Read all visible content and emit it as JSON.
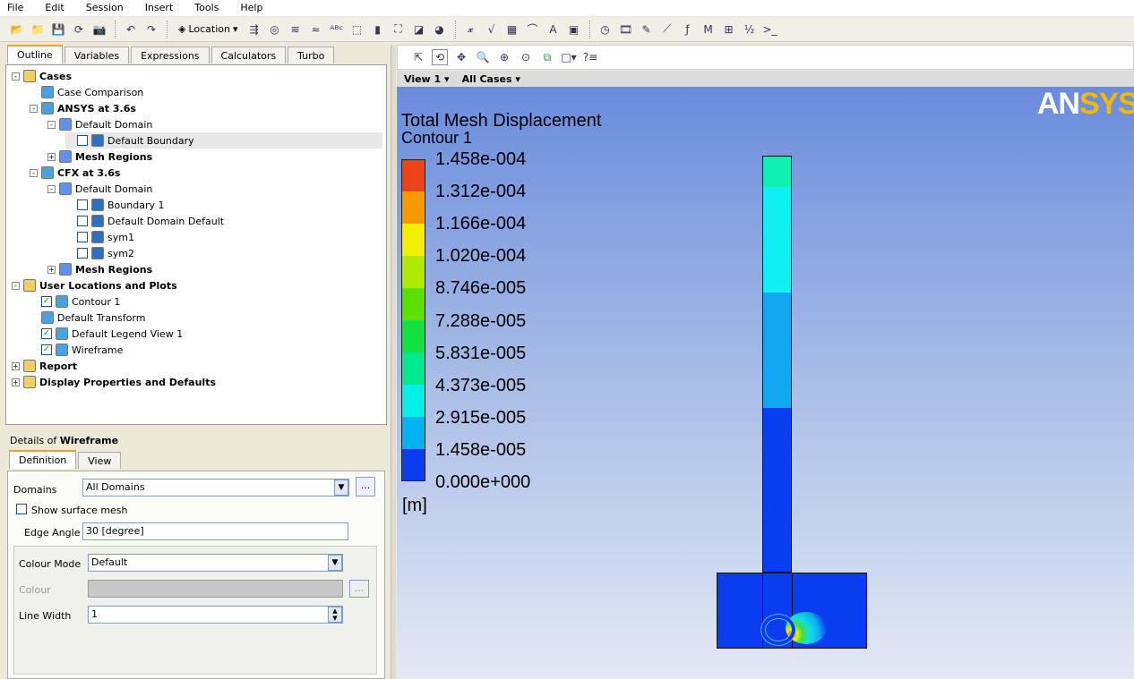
{
  "menu": [
    "File",
    "Edit",
    "Session",
    "Insert",
    "Tools",
    "Help"
  ],
  "toolbar": {
    "location_label": "Location"
  },
  "left_tabs": [
    "Outline",
    "Variables",
    "Expressions",
    "Calculators",
    "Turbo"
  ],
  "tree": [
    {
      "label": "Cases",
      "bold": true,
      "level": 0,
      "exp": "-"
    },
    {
      "label": "Case Comparison",
      "level": 1
    },
    {
      "label": "ANSYS at 3.6s",
      "bold": true,
      "level": 1,
      "exp": "-"
    },
    {
      "label": "Default Domain",
      "level": 2,
      "exp": "-"
    },
    {
      "label": "Default Boundary",
      "level": 3,
      "check": false,
      "selected": true
    },
    {
      "label": "Mesh Regions",
      "bold": true,
      "level": 2,
      "exp": "+"
    },
    {
      "label": "CFX at 3.6s",
      "bold": true,
      "level": 1,
      "exp": "-"
    },
    {
      "label": "Default Domain",
      "level": 2,
      "exp": "-"
    },
    {
      "label": "Boundary 1",
      "level": 3,
      "check": false
    },
    {
      "label": "Default Domain Default",
      "level": 3,
      "check": false
    },
    {
      "label": "sym1",
      "level": 3,
      "check": false
    },
    {
      "label": "sym2",
      "level": 3,
      "check": false
    },
    {
      "label": "Mesh Regions",
      "bold": true,
      "level": 2,
      "exp": "+"
    },
    {
      "label": "User Locations and Plots",
      "bold": true,
      "level": 0,
      "exp": "-"
    },
    {
      "label": "Contour 1",
      "level": 1,
      "check": true
    },
    {
      "label": "Default Transform",
      "level": 1
    },
    {
      "label": "Default Legend View 1",
      "level": 1,
      "check": true
    },
    {
      "label": "Wireframe",
      "level": 1,
      "check": true
    },
    {
      "label": "Report",
      "bold": true,
      "level": 0,
      "exp": "+"
    },
    {
      "label": "Display Properties and Defaults",
      "bold": true,
      "level": 0,
      "exp": "+"
    }
  ],
  "details": {
    "title_prefix": "Details of ",
    "title_object": "Wireframe",
    "tabs": [
      "Definition",
      "View"
    ],
    "domains_label": "Domains",
    "domains_value": "All Domains",
    "more": "...",
    "show_mesh_label": "Show surface mesh",
    "edge_angle_label": "Edge Angle",
    "edge_angle_value": "30 [degree]",
    "colour_mode_label": "Colour Mode",
    "colour_mode_value": "Default",
    "colour_label": "Colour",
    "line_width_label": "Line Width",
    "line_width_value": "1"
  },
  "view": {
    "view_label": "View 1",
    "cases_label": "All Cases"
  },
  "logo": "ANSYS",
  "legend": {
    "title": "Total Mesh Displacement",
    "subtitle": "Contour 1",
    "labels": [
      "1.458e-004",
      "1.312e-004",
      "1.166e-004",
      "1.020e-004",
      "8.746e-005",
      "7.288e-005",
      "5.831e-005",
      "4.373e-005",
      "2.915e-005",
      "1.458e-005",
      "0.000e+000"
    ],
    "colors": [
      "#e8461a",
      "#f59a00",
      "#f2ef00",
      "#b0ea00",
      "#5ce000",
      "#14e040",
      "#00e890",
      "#00f0e8",
      "#00b4f0",
      "#0a3cf0"
    ],
    "unit": "[m]"
  }
}
